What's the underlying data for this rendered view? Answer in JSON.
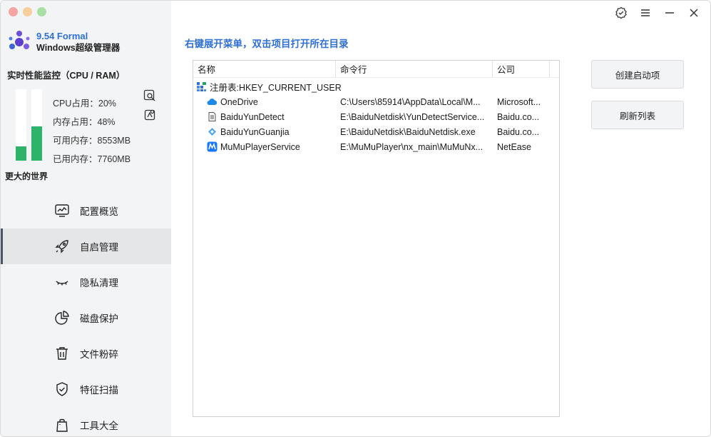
{
  "brand": {
    "version": "9.54 Formal",
    "name": "Windows超级管理器"
  },
  "monitor": {
    "title": "实时性能监控（CPU / RAM）",
    "cpu_percent": 20,
    "ram_percent": 48,
    "cpu_label": "CPU占用：20%",
    "ram_label": "内存占用：48%",
    "available_label": "可用内存：8553MB",
    "used_label": "已用内存：7760MB",
    "bar_color": "#2db36a"
  },
  "slogan": "更大的世界",
  "nav": [
    {
      "label": "配置概览",
      "icon": "monitor-chart-icon",
      "active": false
    },
    {
      "label": "自启管理",
      "icon": "rocket-icon",
      "active": true
    },
    {
      "label": "隐私清理",
      "icon": "closed-eye-icon",
      "active": false
    },
    {
      "label": "磁盘保护",
      "icon": "pie-chart-icon",
      "active": false
    },
    {
      "label": "文件粉碎",
      "icon": "trash-icon",
      "active": false
    },
    {
      "label": "特征扫描",
      "icon": "shield-check-icon",
      "active": false
    },
    {
      "label": "工具大全",
      "icon": "bag-icon",
      "active": false
    }
  ],
  "hint": "右键展开菜单，双击项目打开所在目录",
  "table": {
    "columns": [
      "名称",
      "命令行",
      "公司"
    ],
    "root": "注册表:HKEY_CURRENT_USER",
    "rows": [
      {
        "name": "OneDrive",
        "cmd": "C:\\Users\\85914\\AppData\\Local\\M...",
        "company": "Microsoft...",
        "icon": "onedrive-icon"
      },
      {
        "name": "BaiduYunDetect",
        "cmd": "E:\\BaiduNetdisk\\YunDetectService...",
        "company": "Baidu.co...",
        "icon": "document-icon"
      },
      {
        "name": "BaiduYunGuanjia",
        "cmd": "E:\\BaiduNetdisk\\BaiduNetdisk.exe",
        "company": "Baidu.co...",
        "icon": "baidu-cloud-icon"
      },
      {
        "name": "MuMuPlayerService",
        "cmd": "E:\\MuMuPlayer\\nx_main\\MuMuNx...",
        "company": "NetEase",
        "icon": "mumu-icon"
      }
    ]
  },
  "buttons": {
    "create": "创建启动项",
    "refresh": "刷新列表"
  },
  "colors": {
    "accent": "#2f6fd6",
    "sidebar_bg": "#f3f4f6",
    "active_nav_bg": "#e5e6e8"
  }
}
